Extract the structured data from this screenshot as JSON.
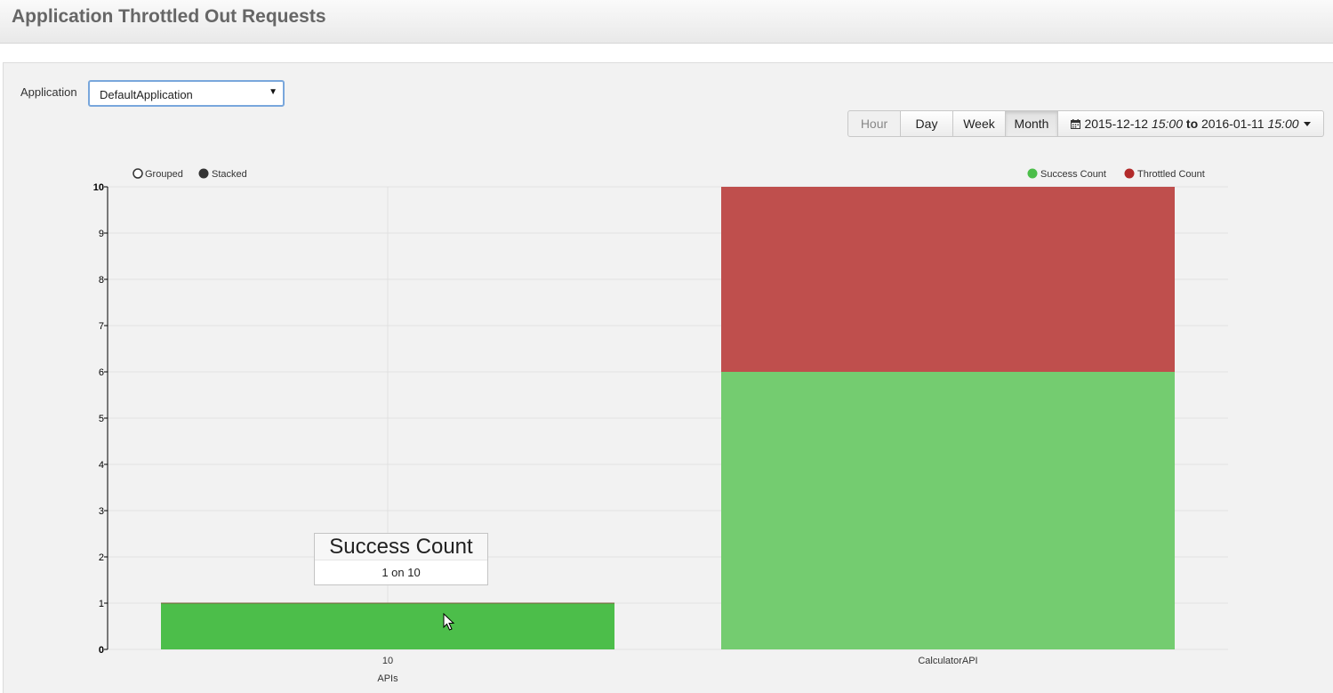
{
  "header": {
    "title": "Application Throttled Out Requests"
  },
  "filter": {
    "label": "Application",
    "selected": "DefaultApplication"
  },
  "range_buttons": {
    "hour": "Hour",
    "day": "Day",
    "week": "Week",
    "month": "Month"
  },
  "date_range": {
    "from_date": "2015-12-12",
    "from_time": "15:00",
    "to_word": "to",
    "to_date": "2016-01-11",
    "to_time": "15:00"
  },
  "controls": {
    "grouped": "Grouped",
    "stacked": "Stacked"
  },
  "tooltip": {
    "title": "Success Count",
    "body": "1 on 10"
  },
  "colors": {
    "success": "#4cbe4a",
    "success_light": "#74cc70",
    "throttled": "#bf4f4d",
    "throttled_legend": "#b22a2a"
  },
  "chart_data": {
    "type": "bar",
    "stacked": true,
    "categories": [
      "10",
      "CalculatorAPI"
    ],
    "series": [
      {
        "name": "Success Count",
        "values": [
          1,
          6
        ]
      },
      {
        "name": "Throttled Count",
        "values": [
          0,
          4
        ]
      }
    ],
    "xlabel": "APIs",
    "ylabel": "",
    "ylim": [
      0,
      10
    ],
    "yticks": [
      0,
      1,
      2,
      3,
      4,
      5,
      6,
      7,
      8,
      9,
      10
    ],
    "grid": true,
    "legend_position": "top-right"
  }
}
